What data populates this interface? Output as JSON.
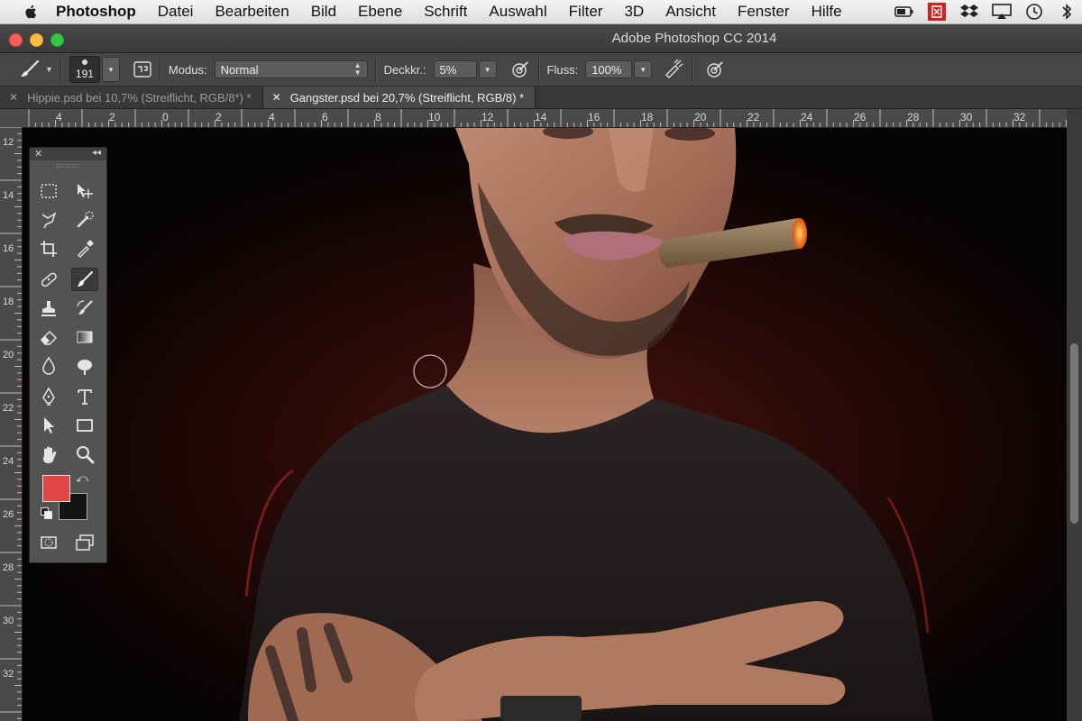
{
  "menubar": {
    "app_name": "Photoshop",
    "items": [
      "Datei",
      "Bearbeiten",
      "Bild",
      "Ebene",
      "Schrift",
      "Auswahl",
      "Filter",
      "3D",
      "Ansicht",
      "Fenster",
      "Hilfe"
    ]
  },
  "window": {
    "title": "Adobe Photoshop CC 2014"
  },
  "options": {
    "brush_size": "191",
    "modus_label": "Modus:",
    "modus_value": "Normal",
    "deckkraft_label": "Deckkr.:",
    "deckkraft_value": "5%",
    "fluss_label": "Fluss:",
    "fluss_value": "100%"
  },
  "tabs": [
    {
      "label": "Hippie.psd bei 10,7% (Streiflicht, RGB/8*) *",
      "active": false
    },
    {
      "label": "Gangster.psd bei 20,7% (Streiflicht, RGB/8) *",
      "active": true
    }
  ],
  "rulers": {
    "top": [
      "4",
      "2",
      "0",
      "2",
      "4",
      "6",
      "8",
      "10",
      "12",
      "14",
      "16",
      "18",
      "20",
      "22",
      "24",
      "26",
      "28",
      "30",
      "32"
    ],
    "left": [
      "12",
      "14",
      "16",
      "18",
      "20",
      "22",
      "24",
      "26",
      "28",
      "30",
      "32"
    ]
  },
  "colors": {
    "foreground": "#e04646",
    "background": "#141414",
    "ui_dark": "#464646",
    "accent_tab": "#4a4a4a"
  },
  "tools": [
    "rect-marquee",
    "move",
    "lasso",
    "quick-select",
    "crop",
    "eyedropper",
    "healing-brush",
    "brush",
    "clone-stamp",
    "history-brush",
    "eraser",
    "gradient",
    "blur",
    "dodge",
    "pen",
    "type",
    "path-select",
    "rectangle-shape",
    "hand",
    "zoom"
  ]
}
